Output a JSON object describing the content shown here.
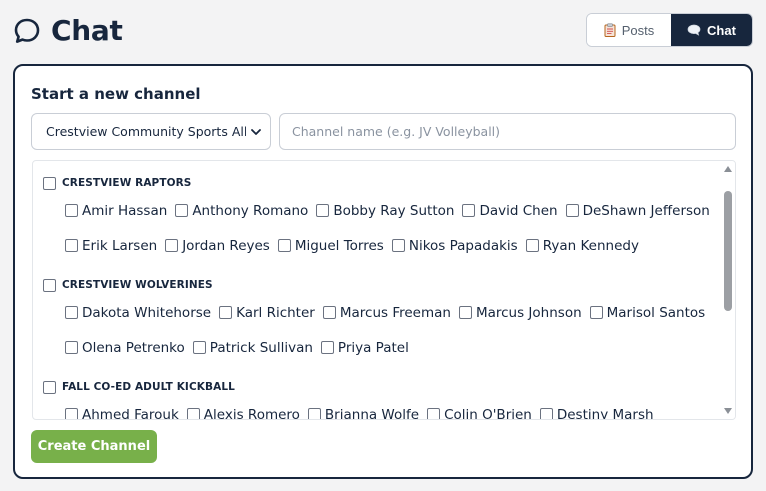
{
  "header": {
    "title": "Chat",
    "icon": "chat-bubble-icon"
  },
  "view_toggle": {
    "posts_label": "Posts",
    "chat_label": "Chat",
    "active": "Chat",
    "posts_icon": "clipboard-icon",
    "chat_icon": "speech-bubble-icon"
  },
  "new_channel": {
    "title": "Start a new channel",
    "organization_value": "Crestview Community Sports Alliance",
    "channel_name_placeholder": "Channel name (e.g. JV Volleyball)",
    "channel_name_value": "",
    "create_label": "Create Channel"
  },
  "groups": [
    {
      "name": "CRESTVIEW RAPTORS",
      "rows": [
        [
          "Amir Hassan",
          "Anthony Romano",
          "Bobby Ray Sutton",
          "David Chen",
          "DeShawn Jefferson"
        ],
        [
          "Erik Larsen",
          "Jordan Reyes",
          "Miguel Torres",
          "Nikos Papadakis",
          "Ryan Kennedy"
        ]
      ]
    },
    {
      "name": "CRESTVIEW WOLVERINES",
      "rows": [
        [
          "Dakota Whitehorse",
          "Karl Richter",
          "Marcus Freeman",
          "Marcus Johnson",
          "Marisol Santos"
        ],
        [
          "Olena Petrenko",
          "Patrick Sullivan",
          "Priya Patel"
        ]
      ]
    },
    {
      "name": "FALL CO-ED ADULT KICKBALL",
      "rows": [
        [
          "Ahmed Farouk",
          "Alexis Romero",
          "Brianna Wolfe",
          "Colin O'Brien",
          "Destiny Marsh"
        ]
      ]
    }
  ],
  "colors": {
    "navy": "#17263d",
    "accent_green": "#78b04a",
    "background": "#f3f3f4"
  }
}
